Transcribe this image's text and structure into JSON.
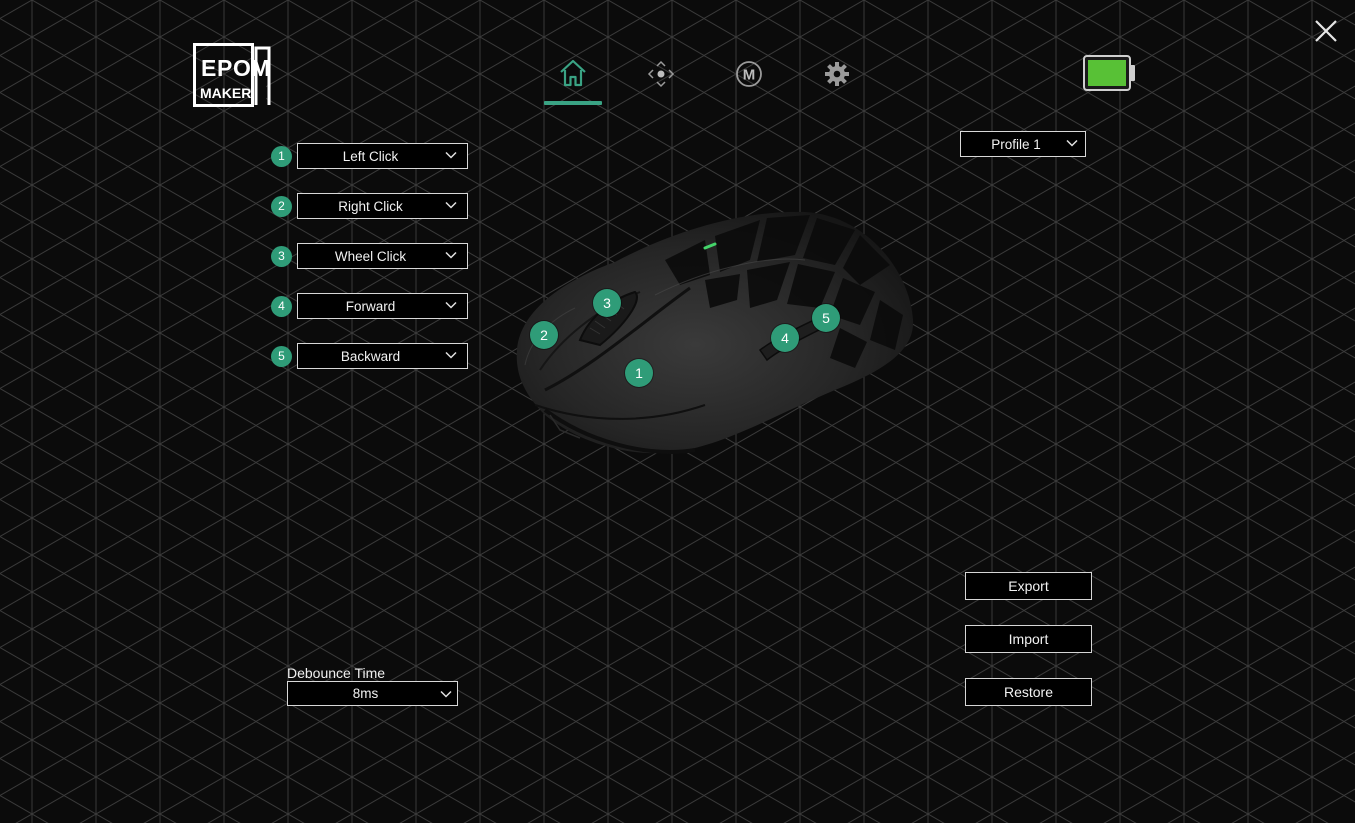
{
  "brand": {
    "logo_letters": [
      "E",
      "P",
      "O",
      "M",
      "MAKER"
    ]
  },
  "nav": {
    "items": [
      {
        "name": "home-icon",
        "active": true
      },
      {
        "name": "dpi-icon",
        "active": false
      },
      {
        "name": "macro-icon",
        "active": false
      },
      {
        "name": "gear-icon",
        "active": false
      }
    ],
    "macro_letter": "M",
    "accent": "#3aa384"
  },
  "battery": {
    "level": 1.0,
    "color": "#58c136"
  },
  "buttons": [
    {
      "num": "1",
      "value": "Left Click"
    },
    {
      "num": "2",
      "value": "Right Click"
    },
    {
      "num": "3",
      "value": "Wheel Click"
    },
    {
      "num": "4",
      "value": "Forward"
    },
    {
      "num": "5",
      "value": "Backward"
    }
  ],
  "hotspots": [
    "1",
    "2",
    "3",
    "4",
    "5"
  ],
  "profile": {
    "value": "Profile 1"
  },
  "actions": {
    "export": "Export",
    "import": "Import",
    "restore": "Restore"
  },
  "debounce": {
    "label": "Debounce Time",
    "value": "8ms"
  }
}
